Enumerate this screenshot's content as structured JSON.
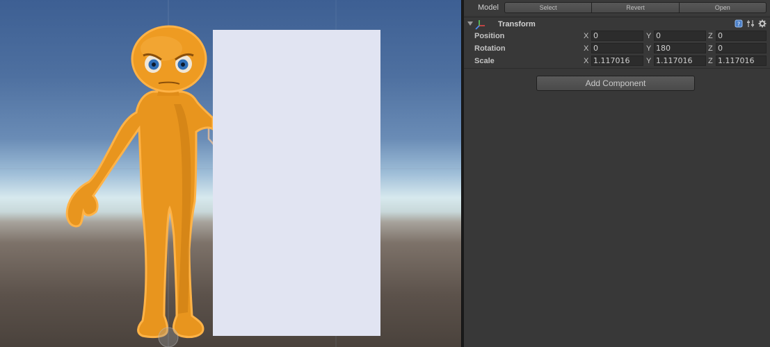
{
  "inspector": {
    "model": {
      "label": "Model",
      "buttons": [
        "Select",
        "Revert",
        "Open"
      ]
    },
    "component": {
      "title": "Transform",
      "icons": [
        "help-icon",
        "preset-icon",
        "gear-icon"
      ]
    },
    "fields": [
      {
        "label": "Position",
        "x": "0",
        "y": "0",
        "z": "0"
      },
      {
        "label": "Rotation",
        "x": "0",
        "y": "180",
        "z": "0"
      },
      {
        "label": "Scale",
        "x": "1.117016",
        "y": "1.117016",
        "z": "1.117016"
      }
    ],
    "axes": {
      "x": "X",
      "y": "Y",
      "z": "Z"
    },
    "add_component": "Add Component"
  },
  "scene": {
    "character": "orange-alien-character",
    "quad": "white-quad"
  },
  "colors": {
    "inspector_bg": "#383838",
    "selection_outline": "#f5a623",
    "character_body": "#e8951e",
    "quad": "#e1e4f2"
  }
}
